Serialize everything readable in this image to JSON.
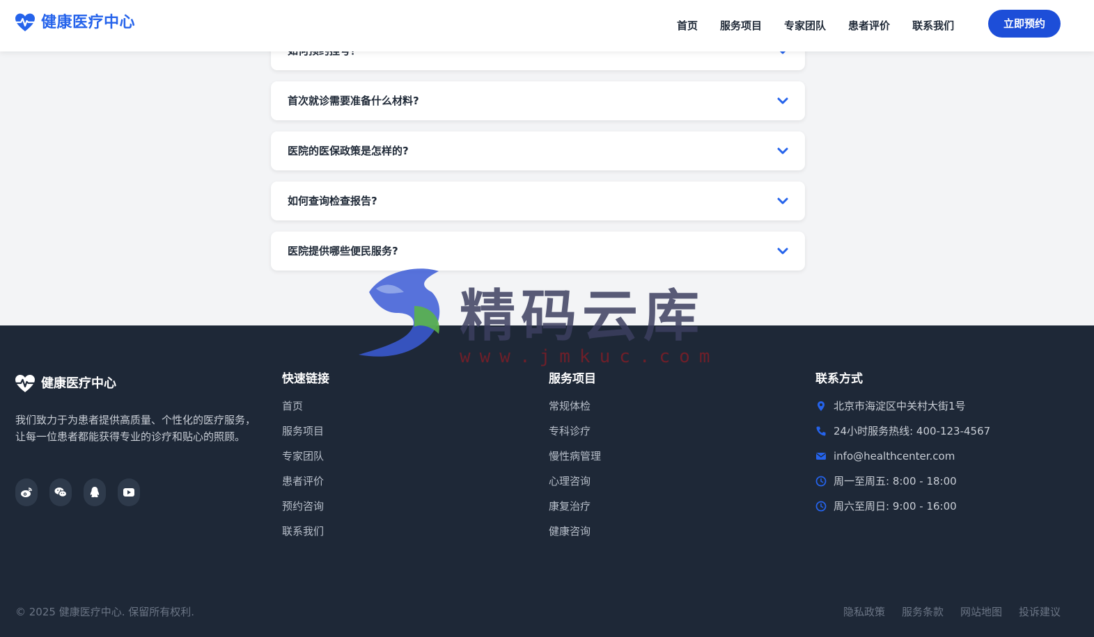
{
  "header": {
    "brand_name": "健康医疗中心",
    "nav": [
      "首页",
      "服务项目",
      "专家团队",
      "患者评价",
      "联系我们"
    ],
    "cta_label": "立即预约"
  },
  "faq": {
    "items": [
      "如何预约挂号？",
      "首次就诊需要准备什么材料?",
      "医院的医保政策是怎样的?",
      "如何查询检查报告?",
      "医院提供哪些便民服务?"
    ]
  },
  "watermark": {
    "text": "精码云库",
    "url": "www.jmkuc.com"
  },
  "footer": {
    "brand_name": "健康医疗中心",
    "description": "我们致力于为患者提供高质量、个性化的医疗服务，让每一位患者都能获得专业的诊疗和贴心的照顾。",
    "socials": [
      "weibo-icon",
      "wechat-icon",
      "qq-icon",
      "youtube-icon"
    ],
    "quick_links": {
      "title": "快速链接",
      "items": [
        "首页",
        "服务项目",
        "专家团队",
        "患者评价",
        "预约咨询",
        "联系我们"
      ]
    },
    "services": {
      "title": "服务项目",
      "items": [
        "常规体检",
        "专科诊疗",
        "慢性病管理",
        "心理咨询",
        "康复治疗",
        "健康咨询"
      ]
    },
    "contact": {
      "title": "联系方式",
      "items": [
        {
          "icon": "location-icon",
          "text": "北京市海淀区中关村大街1号"
        },
        {
          "icon": "phone-icon",
          "text": "24小时服务热线: 400-123-4567"
        },
        {
          "icon": "email-icon",
          "text": "info@healthcenter.com"
        },
        {
          "icon": "clock-icon",
          "text": "周一至周五: 8:00 - 18:00"
        },
        {
          "icon": "clock-icon",
          "text": "周六至周日: 9:00 - 16:00"
        }
      ]
    },
    "copyright": "© 2025 健康医疗中心. 保留所有权利.",
    "bottom_links": [
      "隐私政策",
      "服务条款",
      "网站地图",
      "投诉建议"
    ]
  },
  "colors": {
    "accent": "#2563eb",
    "footer_bg": "#1e2837",
    "page_bg": "#f3f4f6"
  }
}
